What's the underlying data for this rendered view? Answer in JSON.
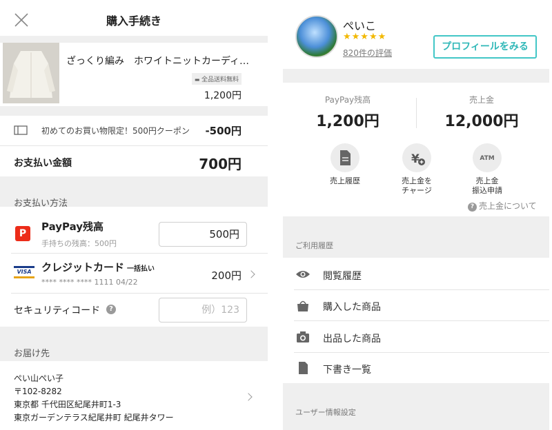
{
  "checkout": {
    "title": "購入手続き",
    "product": {
      "name": "ざっくり編み　ホワイトニットカーディ…",
      "shipping_badge": "全品送料無料",
      "price": "1,200円"
    },
    "coupon": {
      "text": "初めてのお買い物限定！500円クーポン",
      "value": "-500円"
    },
    "total": {
      "label": "お支払い金額",
      "value": "700円"
    },
    "payment_section": "お支払い方法",
    "paypay": {
      "icon_letter": "P",
      "label": "PayPay残高",
      "sub": "手持ちの残高：500円",
      "amount": "500円"
    },
    "credit": {
      "brand": "VISA",
      "label": "クレジットカード",
      "plan": "一括払い",
      "number": "**** **** **** 1111 04/22",
      "amount": "200円"
    },
    "security": {
      "label": "セキュリティコード",
      "placeholder": "例）123"
    },
    "shipping_section": "お届け先",
    "address": {
      "name": "ぺい山ぺい子",
      "zip": "〒102-8282",
      "line1": "東京都 千代田区紀尾井町1-3",
      "line2": "東京ガーデンテラス紀尾井町 紀尾井タワー"
    }
  },
  "mypage": {
    "user": {
      "name": "ぺいこ",
      "stars": "★★★★★",
      "rating": 5,
      "reviews": "820件の評価"
    },
    "profile_button": "プロフィールをみる",
    "paypay_balance": {
      "label": "PayPay残高",
      "value": "1,200円"
    },
    "sales": {
      "label": "売上金",
      "value": "12,000円"
    },
    "actions": {
      "history": "売上履歴",
      "charge_1": "売上金を",
      "charge_2": "チャージ",
      "withdraw_1": "売上金",
      "withdraw_2": "振込申請",
      "atm_icon_text": "ATM"
    },
    "about_link": "売上金について",
    "usage_section": "ご利用履歴",
    "list": {
      "browsing": "閲覧履歴",
      "purchased": "購入した商品",
      "listed": "出品した商品",
      "drafts": "下書き一覧"
    },
    "user_settings_section": "ユーザー情報設定"
  },
  "colors": {
    "accent_teal": "#41c6c6",
    "paypay_red": "#ec2c19",
    "star_yellow": "#f2b800",
    "section_gray": "#efefef"
  }
}
